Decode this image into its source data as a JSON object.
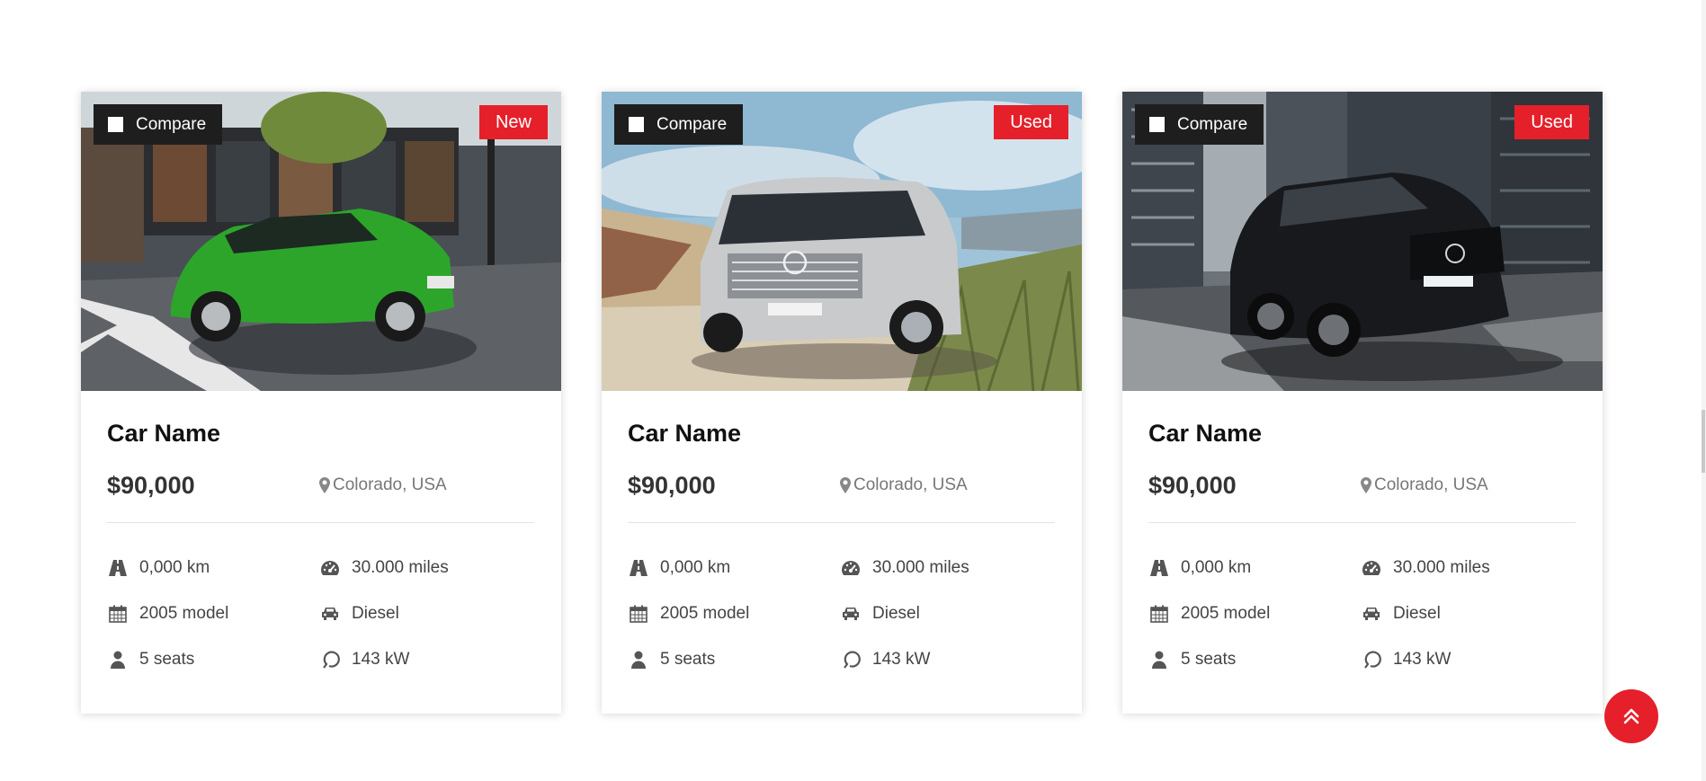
{
  "cards": [
    {
      "compare_label": "Compare",
      "badge": "New",
      "image_subject": "green hatchback in street",
      "name": "Car Name",
      "price": "$90,000",
      "location": "Colorado, USA",
      "specs": {
        "distance": "0,000 km",
        "mileage": "30.000 miles",
        "model": "2005 model",
        "fuel": "Diesel",
        "seats": "5 seats",
        "power": "143 kW"
      }
    },
    {
      "compare_label": "Compare",
      "badge": "Used",
      "image_subject": "silver SUV on beach",
      "name": "Car Name",
      "price": "$90,000",
      "location": "Colorado, USA",
      "specs": {
        "distance": "0,000 km",
        "mileage": "30.000 miles",
        "model": "2005 model",
        "fuel": "Diesel",
        "seats": "5 seats",
        "power": "143 kW"
      }
    },
    {
      "compare_label": "Compare",
      "badge": "Used",
      "image_subject": "black SUV in city",
      "name": "Car Name",
      "price": "$90,000",
      "location": "Colorado, USA",
      "specs": {
        "distance": "0,000 km",
        "mileage": "30.000 miles",
        "model": "2005 model",
        "fuel": "Diesel",
        "seats": "5 seats",
        "power": "143 kW"
      }
    }
  ],
  "icons": {
    "distance": "road-icon",
    "mileage": "tachometer-icon",
    "model": "calendar-icon",
    "fuel": "car-icon",
    "seats": "user-icon",
    "power": "power-icon",
    "location": "map-marker-icon",
    "scroll_top": "double-chevron-up-icon"
  },
  "colors": {
    "accent": "#e5202a",
    "compare_bg": "#1e1e1e",
    "text_dark": "#111111",
    "text_muted": "#777777"
  }
}
